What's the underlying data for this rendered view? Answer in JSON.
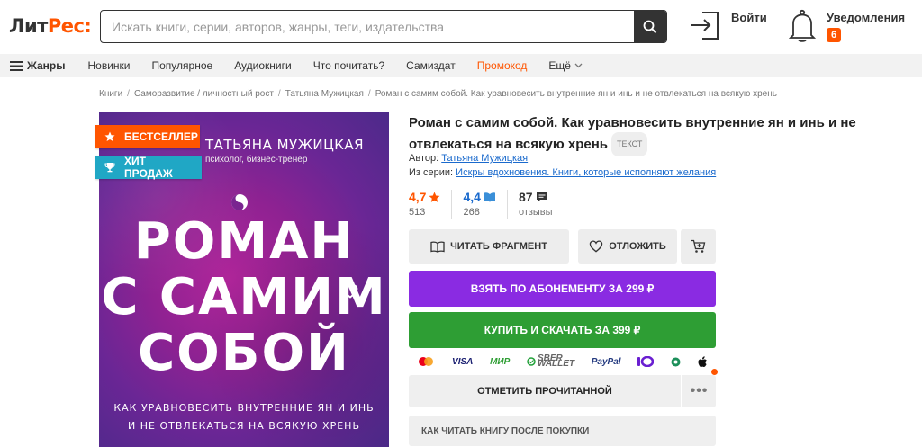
{
  "header": {
    "logo_part1": "Лит",
    "logo_part2": "Рес",
    "logo_colon": ":",
    "search_placeholder": "Искать книги, серии, авторов, жанры, теги, издательства",
    "login_label": "Войти",
    "notifications_label": "Уведомления",
    "notifications_count": "6"
  },
  "nav": {
    "genres_label": "Жанры",
    "items": [
      "Новинки",
      "Популярное",
      "Аудиокниги",
      "Что почитать?",
      "Самиздат",
      "Промокод"
    ],
    "more_label": "Ещё"
  },
  "breadcrumb": [
    "Книги",
    "Саморазвитие / личностный рост",
    "Татьяна Мужицкая",
    "Роман с самим собой. Как уравновесить внутренние ян и инь и не отвлекаться на всякую хрень"
  ],
  "cover": {
    "author": "ТАТЬЯНА МУЖИЦКАЯ",
    "author_sub": "психолог, бизнес-тренер",
    "title_line1": "РОМАН",
    "title_line2": "С САМИМ",
    "title_line3": "СОБОЙ",
    "subtitle_line1": "КАК УРАВНОВЕСИТЬ ВНУТРЕННИЕ ЯН И ИНЬ",
    "subtitle_line2": "И НЕ ОТВЛЕКАТЬСЯ НА ВСЯКУЮ ХРЕНЬ"
  },
  "badges": {
    "bestseller": "БЕСТСЕЛЛЕР",
    "hit": "ХИТ ПРОДАЖ"
  },
  "book": {
    "title": "Роман с самим собой. Как уравновесить внутренние ян и инь и не отвлекаться на всякую хрень",
    "format_tag": "ТЕКСТ",
    "author_label": "Автор:",
    "author": "Татьяна Мужицкая",
    "series_label": "Из серии:",
    "series": "Искры вдохновения. Книги, которые исполняют желания"
  },
  "ratings": {
    "litres_value": "4,7",
    "litres_count": "513",
    "livelib_value": "4,4",
    "livelib_count": "268",
    "reviews_count": "87",
    "reviews_label": "отзывы"
  },
  "actions": {
    "read_fragment": "ЧИТАТЬ ФРАГМЕНТ",
    "defer": "ОТЛОЖИТЬ",
    "subscribe": "ВЗЯТЬ ПО АБОНЕМЕНТУ ЗА 299 ₽",
    "buy": "КУПИТЬ И СКАЧАТЬ ЗА 399 ₽",
    "mark_read": "ОТМЕТИТЬ ПРОЧИТАННОЙ",
    "more": "•••",
    "how_to_read": "КАК ЧИТАТЬ КНИГУ ПОСЛЕ ПОКУПКИ"
  },
  "payments": {
    "visa": "VISA",
    "mir": "МИР",
    "sber_line1": "SBER",
    "sber_line2": "WALLET",
    "paypal": "PayPal",
    "yoomoney": "Ю"
  },
  "colors": {
    "brand_orange": "#ff5500",
    "subscribe_purple": "#8a2be2",
    "buy_green": "#2e9e34",
    "link_blue": "#1a6acd",
    "hit_teal": "#20a7c5"
  }
}
